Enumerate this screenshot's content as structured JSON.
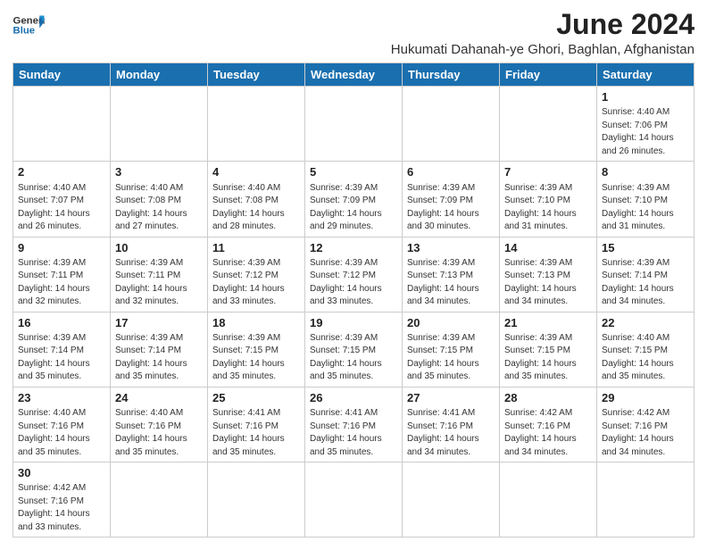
{
  "header": {
    "logo_line1": "General",
    "logo_line2": "Blue",
    "month_year": "June 2024",
    "location": "Hukumati Dahanah-ye Ghori, Baghlan, Afghanistan"
  },
  "weekdays": [
    "Sunday",
    "Monday",
    "Tuesday",
    "Wednesday",
    "Thursday",
    "Friday",
    "Saturday"
  ],
  "weeks": [
    [
      {
        "day": "",
        "info": ""
      },
      {
        "day": "",
        "info": ""
      },
      {
        "day": "",
        "info": ""
      },
      {
        "day": "",
        "info": ""
      },
      {
        "day": "",
        "info": ""
      },
      {
        "day": "",
        "info": ""
      },
      {
        "day": "1",
        "info": "Sunrise: 4:40 AM\nSunset: 7:06 PM\nDaylight: 14 hours\nand 26 minutes."
      }
    ],
    [
      {
        "day": "2",
        "info": "Sunrise: 4:40 AM\nSunset: 7:07 PM\nDaylight: 14 hours\nand 26 minutes."
      },
      {
        "day": "3",
        "info": "Sunrise: 4:40 AM\nSunset: 7:08 PM\nDaylight: 14 hours\nand 27 minutes."
      },
      {
        "day": "4",
        "info": "Sunrise: 4:40 AM\nSunset: 7:08 PM\nDaylight: 14 hours\nand 28 minutes."
      },
      {
        "day": "5",
        "info": "Sunrise: 4:39 AM\nSunset: 7:09 PM\nDaylight: 14 hours\nand 29 minutes."
      },
      {
        "day": "6",
        "info": "Sunrise: 4:39 AM\nSunset: 7:09 PM\nDaylight: 14 hours\nand 30 minutes."
      },
      {
        "day": "7",
        "info": "Sunrise: 4:39 AM\nSunset: 7:10 PM\nDaylight: 14 hours\nand 31 minutes."
      },
      {
        "day": "8",
        "info": "Sunrise: 4:39 AM\nSunset: 7:10 PM\nDaylight: 14 hours\nand 31 minutes."
      }
    ],
    [
      {
        "day": "9",
        "info": "Sunrise: 4:39 AM\nSunset: 7:11 PM\nDaylight: 14 hours\nand 32 minutes."
      },
      {
        "day": "10",
        "info": "Sunrise: 4:39 AM\nSunset: 7:11 PM\nDaylight: 14 hours\nand 32 minutes."
      },
      {
        "day": "11",
        "info": "Sunrise: 4:39 AM\nSunset: 7:12 PM\nDaylight: 14 hours\nand 33 minutes."
      },
      {
        "day": "12",
        "info": "Sunrise: 4:39 AM\nSunset: 7:12 PM\nDaylight: 14 hours\nand 33 minutes."
      },
      {
        "day": "13",
        "info": "Sunrise: 4:39 AM\nSunset: 7:13 PM\nDaylight: 14 hours\nand 34 minutes."
      },
      {
        "day": "14",
        "info": "Sunrise: 4:39 AM\nSunset: 7:13 PM\nDaylight: 14 hours\nand 34 minutes."
      },
      {
        "day": "15",
        "info": "Sunrise: 4:39 AM\nSunset: 7:14 PM\nDaylight: 14 hours\nand 34 minutes."
      }
    ],
    [
      {
        "day": "16",
        "info": "Sunrise: 4:39 AM\nSunset: 7:14 PM\nDaylight: 14 hours\nand 35 minutes."
      },
      {
        "day": "17",
        "info": "Sunrise: 4:39 AM\nSunset: 7:14 PM\nDaylight: 14 hours\nand 35 minutes."
      },
      {
        "day": "18",
        "info": "Sunrise: 4:39 AM\nSunset: 7:15 PM\nDaylight: 14 hours\nand 35 minutes."
      },
      {
        "day": "19",
        "info": "Sunrise: 4:39 AM\nSunset: 7:15 PM\nDaylight: 14 hours\nand 35 minutes."
      },
      {
        "day": "20",
        "info": "Sunrise: 4:39 AM\nSunset: 7:15 PM\nDaylight: 14 hours\nand 35 minutes."
      },
      {
        "day": "21",
        "info": "Sunrise: 4:39 AM\nSunset: 7:15 PM\nDaylight: 14 hours\nand 35 minutes."
      },
      {
        "day": "22",
        "info": "Sunrise: 4:40 AM\nSunset: 7:15 PM\nDaylight: 14 hours\nand 35 minutes."
      }
    ],
    [
      {
        "day": "23",
        "info": "Sunrise: 4:40 AM\nSunset: 7:16 PM\nDaylight: 14 hours\nand 35 minutes."
      },
      {
        "day": "24",
        "info": "Sunrise: 4:40 AM\nSunset: 7:16 PM\nDaylight: 14 hours\nand 35 minutes."
      },
      {
        "day": "25",
        "info": "Sunrise: 4:41 AM\nSunset: 7:16 PM\nDaylight: 14 hours\nand 35 minutes."
      },
      {
        "day": "26",
        "info": "Sunrise: 4:41 AM\nSunset: 7:16 PM\nDaylight: 14 hours\nand 35 minutes."
      },
      {
        "day": "27",
        "info": "Sunrise: 4:41 AM\nSunset: 7:16 PM\nDaylight: 14 hours\nand 34 minutes."
      },
      {
        "day": "28",
        "info": "Sunrise: 4:42 AM\nSunset: 7:16 PM\nDaylight: 14 hours\nand 34 minutes."
      },
      {
        "day": "29",
        "info": "Sunrise: 4:42 AM\nSunset: 7:16 PM\nDaylight: 14 hours\nand 34 minutes."
      }
    ],
    [
      {
        "day": "30",
        "info": "Sunrise: 4:42 AM\nSunset: 7:16 PM\nDaylight: 14 hours\nand 33 minutes."
      },
      {
        "day": "",
        "info": ""
      },
      {
        "day": "",
        "info": ""
      },
      {
        "day": "",
        "info": ""
      },
      {
        "day": "",
        "info": ""
      },
      {
        "day": "",
        "info": ""
      },
      {
        "day": "",
        "info": ""
      }
    ]
  ]
}
